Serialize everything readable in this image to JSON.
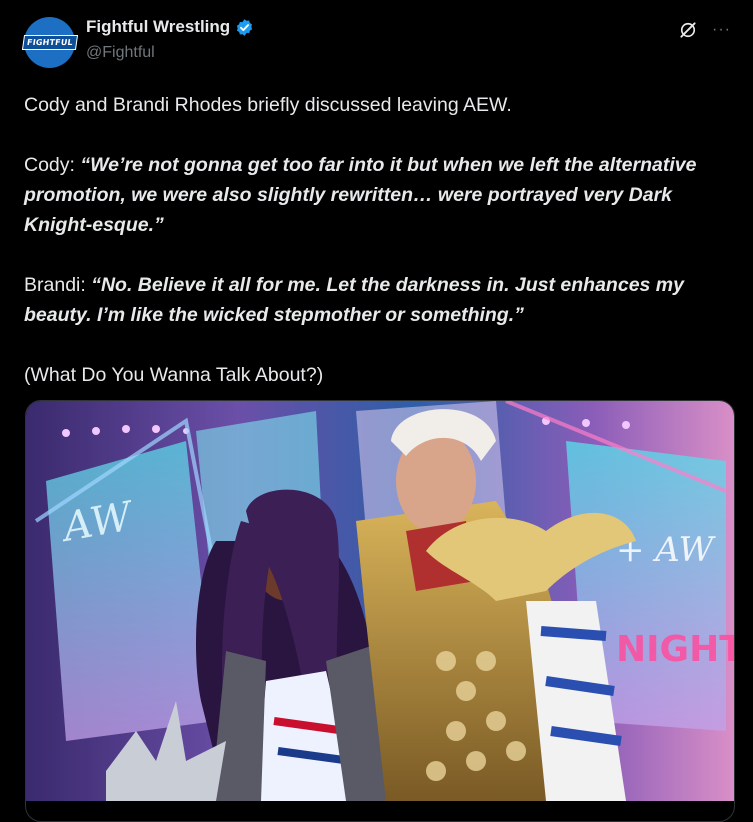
{
  "author": {
    "avatar_text": "FIGHTFUL",
    "display_name": "Fightful Wrestling",
    "handle": "@Fightful",
    "verified_icon": "verified-badge-icon"
  },
  "header_icons": {
    "grok": "grok-icon",
    "more": "···"
  },
  "post": {
    "line1": "Cody and Brandi Rhodes briefly discussed leaving AEW.",
    "cody_label": "Cody: ",
    "cody_quote": "“We’re not gonna get too far into it but when we left the alternative promotion, we were also slightly rewritten… were portrayed very Dark Knight-esque.”",
    "brandi_label": "Brandi: ",
    "brandi_quote": "“No. Believe it all for me. Let the darkness in. Just enhances my beauty. I’m like the wicked stepmother or something.”",
    "source": "(What Do You Wanna Talk About?)"
  },
  "media": {
    "left_sign": "AW",
    "right_sign": "+ AW",
    "right_sign2": "NIGHT"
  },
  "colors": {
    "background": "#000000",
    "text": "#e7e9ea",
    "muted": "#71767b",
    "verified": "#1d9bf0",
    "avatar": "#1d6fc4"
  }
}
